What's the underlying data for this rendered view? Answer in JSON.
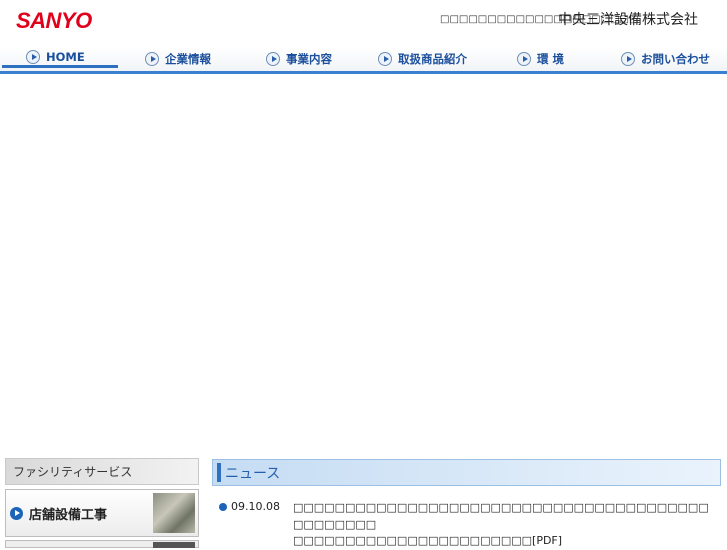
{
  "header": {
    "logo": "SANYO",
    "tagline": "□□□□□□□□□□□□□□□□□□□□□",
    "company": "中央三洋設備株式会社"
  },
  "nav": {
    "items": [
      {
        "label": "HOME",
        "active": true
      },
      {
        "label": "企業情報"
      },
      {
        "label": "事業内容"
      },
      {
        "label": "取扱商品紹介"
      },
      {
        "label": "環 境"
      },
      {
        "label": "お問い合わせ"
      }
    ]
  },
  "sidebar": {
    "heading": "ファシリティサービス",
    "card_label": "店舗設備工事"
  },
  "news": {
    "heading": "ニュース",
    "items": [
      {
        "date": "09.10.08",
        "text": "□□□□□□□□□□□□□□□□□□□□□□□□□□□□□□□□□□□□□□□□□□□□□□□□",
        "link": "□□□□□□□□□□□□□□□□□□□□□□□[PDF]"
      }
    ]
  },
  "colors": {
    "brand": "#e0001b",
    "accent": "#2e6fc0"
  }
}
